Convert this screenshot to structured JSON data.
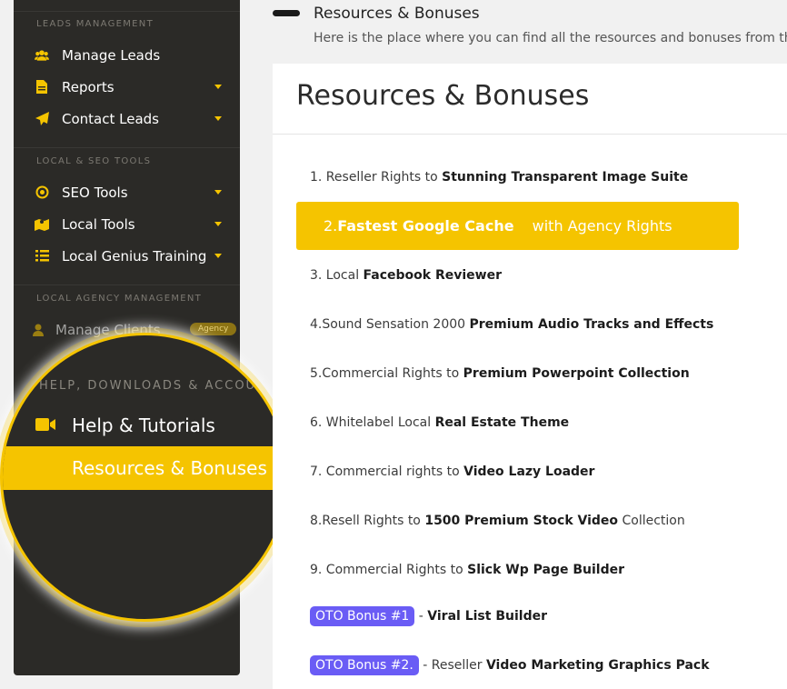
{
  "sidebar": {
    "sections": [
      {
        "title": "LEADS MANAGEMENT"
      },
      {
        "title": "LOCAL & SEO TOOLS"
      },
      {
        "title": "LOCAL AGENCY MANAGEMENT"
      }
    ],
    "items": [
      {
        "label": "Manage Leads",
        "icon": "users-icon",
        "dropdown": false
      },
      {
        "label": "Reports",
        "icon": "document-icon",
        "dropdown": true
      },
      {
        "label": "Contact Leads",
        "icon": "paper-plane-icon",
        "dropdown": true
      },
      {
        "label": "SEO Tools",
        "icon": "target-icon",
        "dropdown": true
      },
      {
        "label": "Local Tools",
        "icon": "map-icon",
        "dropdown": true
      },
      {
        "label": "Local Genius Training",
        "icon": "list-icon",
        "dropdown": true
      },
      {
        "label": "Manage Clients",
        "icon": "user-icon",
        "badge": "Agency"
      }
    ]
  },
  "magnifier": {
    "section_title": "HELP, DOWNLOADS & ACCOU",
    "help_label": "Help & Tutorials",
    "resources_label": "Resources & Bonuses"
  },
  "header": {
    "title": "Resources & Bonuses",
    "subtitle": "Here is the place where you can find all the resources and bonuses from the sof"
  },
  "panel": {
    "title": "Resources & Bonuses",
    "rows": [
      {
        "prefix": "1. Reseller Rights to ",
        "bold": "Stunning Transparent Image Suite",
        "suffix": ""
      },
      {
        "prefix": "2.",
        "bold": "Fastest Google Cache",
        "suffix": " with Agency Rights",
        "highlighted": true
      },
      {
        "prefix": "3. Local ",
        "bold": "Facebook Reviewer",
        "suffix": ""
      },
      {
        "prefix": "4.Sound Sensation 2000 ",
        "bold": "Premium Audio Tracks and Effects",
        "suffix": ""
      },
      {
        "prefix": "5.Commercial Rights to ",
        "bold": "Premium Powerpoint Collection",
        "suffix": ""
      },
      {
        "prefix": "6. Whitelabel Local ",
        "bold": "Real Estate Theme",
        "suffix": ""
      },
      {
        "prefix": "7. Commercial rights to ",
        "bold": "Video Lazy Loader",
        "suffix": ""
      },
      {
        "prefix": "8.Resell Rights to ",
        "bold": "1500 Premium Stock Video",
        "suffix": " Collection"
      },
      {
        "prefix": "9. Commercial Rights to ",
        "bold": "Slick Wp Page Builder",
        "suffix": ""
      }
    ],
    "oto": [
      {
        "badge": "OTO Bonus #1",
        "prefix": " - ",
        "bold": "Viral List Builder"
      },
      {
        "badge": "OTO Bonus #2.",
        "prefix": " - Reseller ",
        "bold": "Video Marketing Graphics Pack"
      }
    ]
  },
  "colors": {
    "accent": "#f5c400",
    "sidebar_bg": "#2b2a27",
    "oto_badge": "#6a5cf5"
  }
}
